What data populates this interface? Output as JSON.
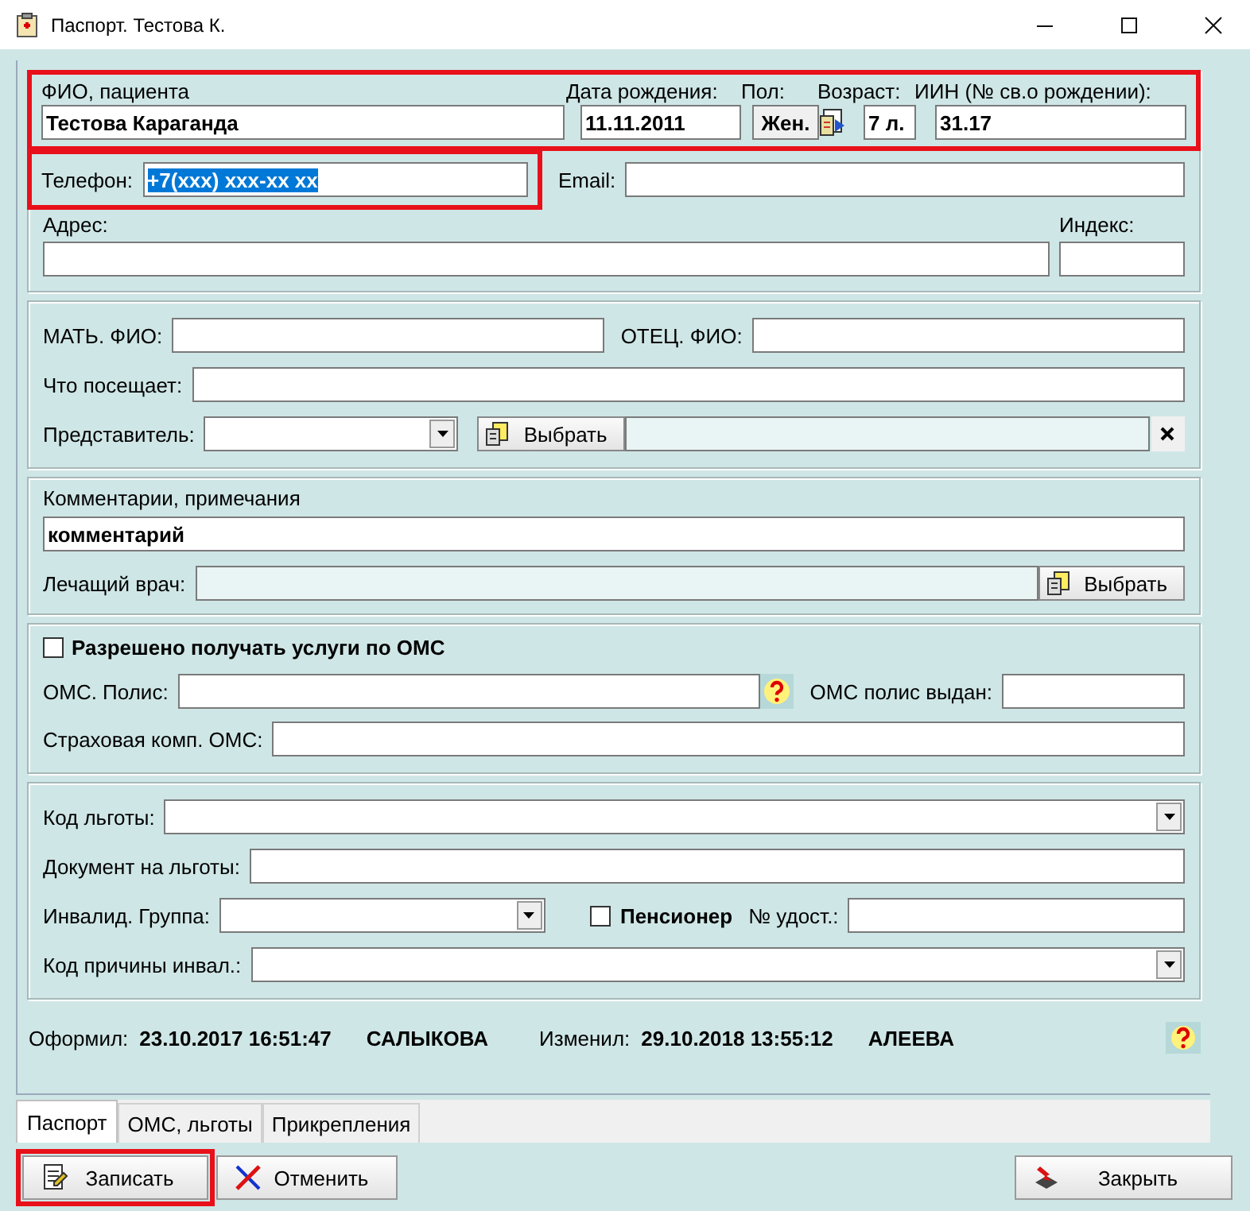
{
  "window": {
    "title": "Паспорт. Тестова К."
  },
  "patient": {
    "highlighted": true,
    "name_label": "ФИО, пациента",
    "name": "Тестова Караганда",
    "birth_label": "Дата рождения:",
    "birth": "11.11.2011",
    "sex_label": "Пол:",
    "sex": "Жен.",
    "age_label": "Возраст:",
    "age": "7 л.",
    "iin_label": "ИИН (№ св.о рождении):",
    "iin": "31.17"
  },
  "contacts": {
    "phone_highlighted": true,
    "phone_label": "Телефон:",
    "phone": "+7(xxx) xxx-xx xx",
    "phone_selected": true,
    "email_label": "Email:",
    "address_label": "Адрес:",
    "index_label": "Индекс:"
  },
  "family": {
    "mother_label": "МАТЬ. ФИО:",
    "father_label": "ОТЕЦ. ФИО:",
    "visits_label": "Что посещает:",
    "representative_label": "Представитель:",
    "choose_button": "Выбрать"
  },
  "notes": {
    "comment_label": "Комментарии, примечания",
    "comment": "комментарий",
    "doctor_label": "Лечащий врач:",
    "choose_button": "Выбрать"
  },
  "oms": {
    "allowed_label": "Разрешено получать услуги по ОМС",
    "allowed": false,
    "policy_label": "ОМС. Полис:",
    "issued_label": "ОМС полис выдан:",
    "insurer_label": "Страховая комп. ОМС:"
  },
  "benefits": {
    "code_label": "Код льготы:",
    "document_label": "Документ на льготы:",
    "disability_label": "Инвалид. Группа:",
    "pensioner_label": "Пенсионер",
    "pensioner": false,
    "certificate_label": "№ удост.:",
    "reason_label": "Код причины инвал.:"
  },
  "record": {
    "created_label": "Оформил:",
    "created": "23.10.2017 16:51:47",
    "created_by": "САЛЫКОВА",
    "changed_label": "Изменил:",
    "changed": "29.10.2018 13:55:12",
    "changed_by": "АЛЕЕВА"
  },
  "tabs": [
    {
      "label": "Паспорт",
      "selected": true
    },
    {
      "label": "ОМС, льготы",
      "selected": false
    },
    {
      "label": "Прикрепления",
      "selected": false
    }
  ],
  "buttons": [
    {
      "label": "Записать",
      "kind": "save",
      "highlighted": true
    },
    {
      "label": "Отменить",
      "kind": "cancel",
      "highlighted": false
    },
    {
      "label": "Закрыть",
      "kind": "close",
      "highlighted": false
    }
  ]
}
